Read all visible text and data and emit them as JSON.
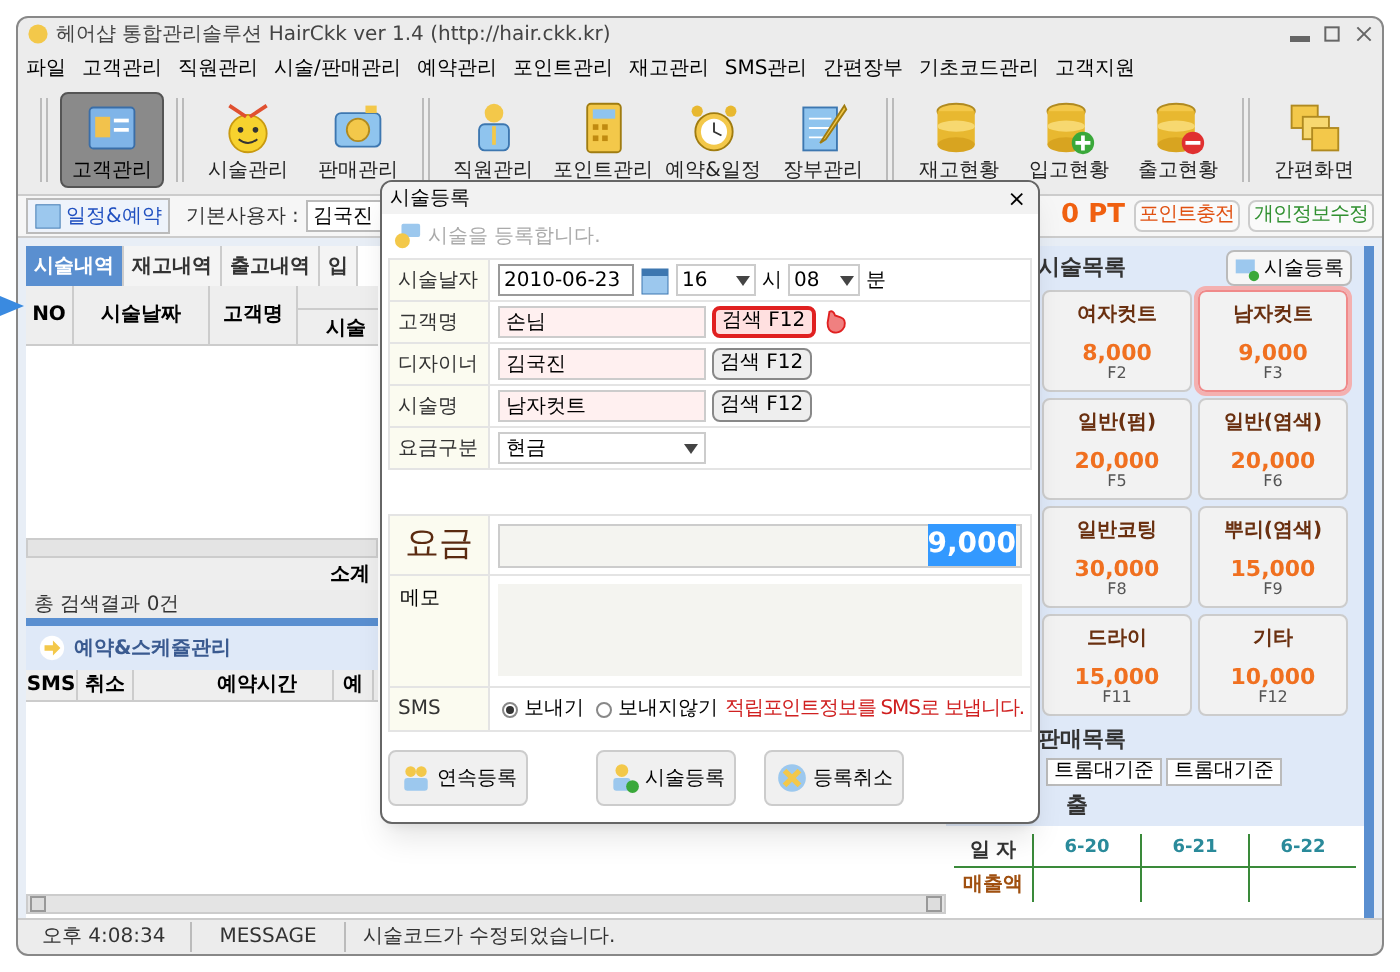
{
  "window": {
    "title": "헤어샵 통합관리솔루션 HairCkk ver 1.4 (http://hair.ckk.kr)"
  },
  "menu": [
    "파일",
    "고객관리",
    "직원관리",
    "시술/판매관리",
    "예약관리",
    "포인트관리",
    "재고관리",
    "SMS관리",
    "간편장부",
    "기초코드관리",
    "고객지원"
  ],
  "toolbar": [
    {
      "items": [
        {
          "label": "고객관리",
          "selected": true
        }
      ]
    },
    {
      "items": [
        {
          "label": "시술관리",
          "selected": false
        },
        {
          "label": "판매관리",
          "selected": false
        }
      ]
    },
    {
      "items": [
        {
          "label": "직원관리",
          "selected": false
        },
        {
          "label": "포인트관리",
          "selected": false
        },
        {
          "label": "예약&일정",
          "selected": false
        },
        {
          "label": "장부관리",
          "selected": false
        }
      ]
    },
    {
      "items": [
        {
          "label": "재고현황",
          "selected": false
        },
        {
          "label": "입고현황",
          "selected": false
        },
        {
          "label": "출고현황",
          "selected": false
        }
      ]
    },
    {
      "items": [
        {
          "label": "간편화면",
          "selected": false
        }
      ]
    }
  ],
  "user_bar": {
    "schedule_button": "일정&예약",
    "user_label": "기본사용자 :",
    "user_value": "김국진",
    "points": "0 PT",
    "buttons": [
      "포인트충전",
      "개인정보수정"
    ]
  },
  "history": {
    "tabs": [
      {
        "label": "시술내역",
        "selected": true
      },
      {
        "label": "재고내역",
        "selected": false
      },
      {
        "label": "출고내역",
        "selected": false
      },
      {
        "label": "입",
        "selected": false
      }
    ],
    "columns": [
      "NO",
      "시술날짜",
      "고객명"
    ],
    "column_sub": "시술",
    "subtotal_label": "소계",
    "result": "총 검색결과 0건"
  },
  "reservations": {
    "title": "예약&스케쥴관리",
    "columns": [
      "SMS",
      "취소",
      "예약시간",
      "예"
    ]
  },
  "dialog": {
    "title": "시술등록",
    "close": "×",
    "heading": "시술을 등록합니다.",
    "fields": [
      {
        "kind": "datetime",
        "label": "시술날자",
        "date": "2010-06-23",
        "hour": "16",
        "hour_unit": "시",
        "minute": "08",
        "minute_unit": "분"
      },
      {
        "kind": "search",
        "label": "고객명",
        "value": "손님",
        "button": "검색 F12",
        "highlighted": true
      },
      {
        "kind": "search",
        "label": "디자이너",
        "value": "김국진",
        "button": "검색 F12",
        "highlighted": false
      },
      {
        "kind": "search",
        "label": "시술명",
        "value": "남자컷트",
        "button": "검색 F12",
        "highlighted": false
      },
      {
        "kind": "select",
        "label": "요금구분",
        "value": "현금"
      }
    ],
    "fee": {
      "label": "요금",
      "value": "9,000",
      "selected": true
    },
    "memo": {
      "label": "메모"
    },
    "sms": {
      "label": "SMS",
      "options": [
        {
          "label": "보내기",
          "selected": true
        },
        {
          "label": "보내지않기",
          "selected": false
        }
      ],
      "note": "적립포인트정보를 SMS로 보냅니다."
    },
    "buttons": [
      "연속등록",
      "시술등록",
      "등록취소"
    ]
  },
  "services": {
    "title": "시술목록",
    "add_button": "시술등록",
    "items": [
      {
        "name": "여자컷트",
        "price": "8,000",
        "key": "F2",
        "selected": false
      },
      {
        "name": "남자컷트",
        "price": "9,000",
        "key": "F3",
        "selected": true
      },
      {
        "name": "일반(펌)",
        "price": "20,000",
        "key": "F5",
        "selected": false
      },
      {
        "name": "일반(염색)",
        "price": "20,000",
        "key": "F6",
        "selected": false
      },
      {
        "name": "일반코팅",
        "price": "30,000",
        "key": "F8",
        "selected": false
      },
      {
        "name": "뿌리(염색)",
        "price": "15,000",
        "key": "F9",
        "selected": false
      },
      {
        "name": "드라이",
        "price": "15,000",
        "key": "F11",
        "selected": false
      },
      {
        "name": "기타",
        "price": "10,000",
        "key": "F12",
        "selected": false
      }
    ]
  },
  "sales": {
    "title": "판매목록",
    "tabs": [
      "트롬대기준",
      "트롬대기준"
    ]
  },
  "revenue": {
    "title": "출",
    "row_labels": [
      "일 자",
      "매출액"
    ],
    "dates": [
      "6-20",
      "6-21",
      "6-22"
    ]
  },
  "status_bar": {
    "time": "오후 4:08:34",
    "type": "MESSAGE",
    "message": "시술코드가 수정되었습니다."
  }
}
